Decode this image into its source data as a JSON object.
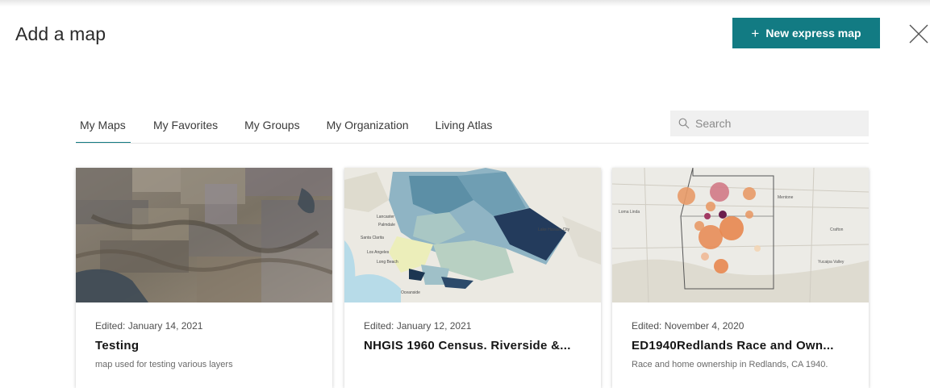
{
  "dialog": {
    "title": "Add a map",
    "new_map_button": {
      "icon": "plus-icon",
      "label": "New express map"
    },
    "close_icon": "close-icon",
    "accent_color": "#127b83"
  },
  "tabs": [
    {
      "label": "My Maps",
      "active": true
    },
    {
      "label": "My Favorites",
      "active": false
    },
    {
      "label": "My Groups",
      "active": false
    },
    {
      "label": "My Organization",
      "active": false
    },
    {
      "label": "Living Atlas",
      "active": false
    }
  ],
  "search": {
    "placeholder": "Search",
    "value": "",
    "icon": "search-icon"
  },
  "cards": [
    {
      "edited": "Edited: January 14, 2021",
      "title": "Testing",
      "description": "map used for testing various layers",
      "thumbnail": "satellite-imagery-thumbnail"
    },
    {
      "edited": "Edited: January 12, 2021",
      "title": "NHGIS 1960 Census. Riverside &...",
      "description": "",
      "thumbnail": "choropleth-county-map-thumbnail",
      "thumbnail_labels": [
        "Lake Havasu City",
        "Santa Clarita",
        "Los Angeles",
        "Long Beach",
        "Oceanside",
        "Palmdale",
        "Lancaster"
      ]
    },
    {
      "edited": "Edited: November 4, 2020",
      "title": "ED1940Redlands Race and Own...",
      "description": "Race and home ownership in Redlands, CA 1940.",
      "thumbnail": "proportional-symbol-map-thumbnail",
      "thumbnail_labels": [
        "Loma Linda",
        "Mentone",
        "Yucaipa Valley",
        "Crafton"
      ]
    }
  ]
}
